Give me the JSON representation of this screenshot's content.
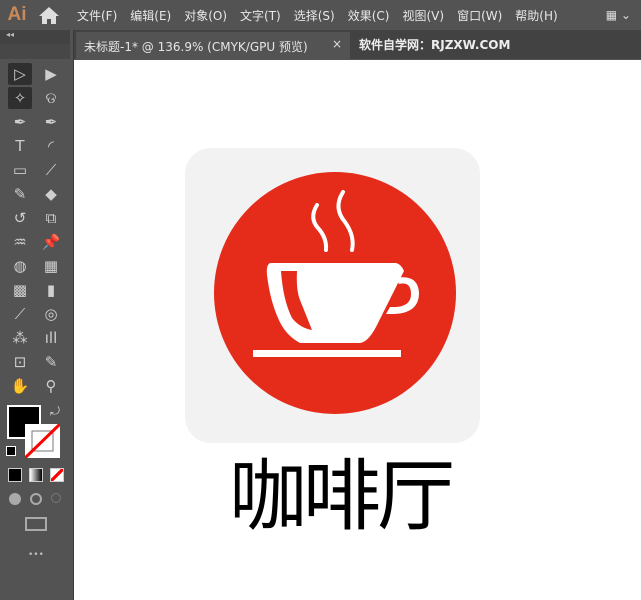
{
  "app": {
    "logo": "Ai"
  },
  "menu": [
    "文件(F)",
    "编辑(E)",
    "对象(O)",
    "文字(T)",
    "选择(S)",
    "效果(C)",
    "视图(V)",
    "窗口(W)",
    "帮助(H)"
  ],
  "tab": {
    "title": "未标题-1* @ 136.9% (CMYK/GPU 预览)",
    "close": "×"
  },
  "watermark": "软件自学网：RJZXW.COM",
  "panel": {
    "collapse": "◂◂",
    "more": "•••"
  },
  "tools": [
    "selection",
    "direct-selection",
    "magic-wand",
    "lasso",
    "pen",
    "curvature",
    "type",
    "arc",
    "rectangle",
    "paintbrush",
    "pencil",
    "eraser",
    "rotate",
    "scale",
    "warp",
    "puppet-warp",
    "shape-builder",
    "perspective-grid",
    "mesh",
    "gradient",
    "eyedropper",
    "blend",
    "symbol-sprayer",
    "column-graph",
    "artboard",
    "slice",
    "hand",
    "zoom"
  ],
  "colors": {
    "fill": "#000000",
    "circle": "#e52b1a",
    "tile": "#f2f2f2",
    "cup": "#ffffff"
  },
  "artwork": {
    "title": "咖啡厅"
  }
}
